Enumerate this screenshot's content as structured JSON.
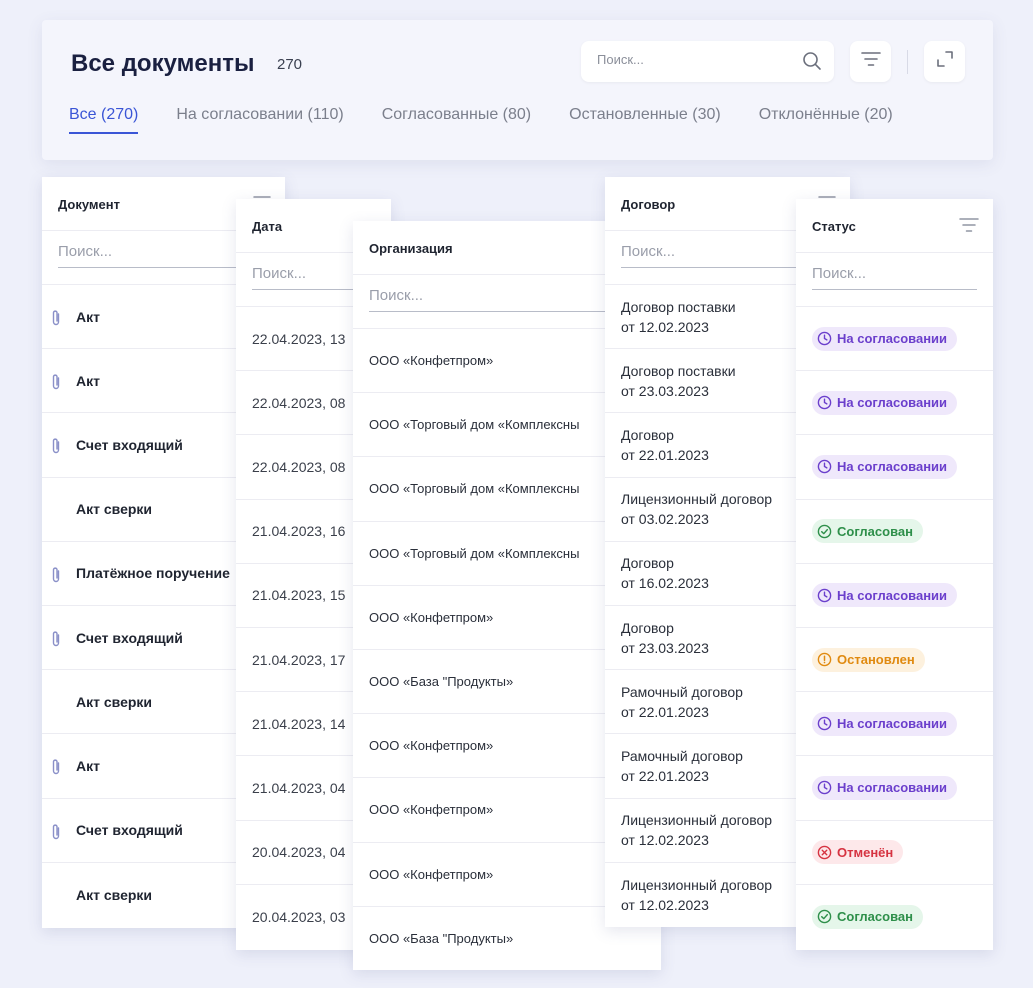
{
  "header": {
    "title": "Все документы",
    "count": "270",
    "search_placeholder": "Поиск...",
    "tabs": [
      {
        "label": "Все (270)",
        "active": true
      },
      {
        "label": "На согласовании (110)"
      },
      {
        "label": "Согласованные (80)"
      },
      {
        "label": "Остановленные (30)"
      },
      {
        "label": "Отклонённые (20)"
      }
    ]
  },
  "colors": {
    "accent": "#3a55d6",
    "pending": "#6b3fcc",
    "approved": "#2e8f4a",
    "stopped": "#e08a10",
    "cancelled": "#d63341"
  },
  "columns": {
    "document": {
      "title": "Документ",
      "search_placeholder": "Поиск..."
    },
    "date": {
      "title": "Дата",
      "search_placeholder": "Поиск..."
    },
    "organization": {
      "title": "Организация",
      "search_placeholder": "Поиск..."
    },
    "contract": {
      "title": "Договор",
      "search_placeholder": "Поиск..."
    },
    "status": {
      "title": "Статус",
      "search_placeholder": "Поиск..."
    }
  },
  "documents": [
    {
      "name": "Акт",
      "attachment": true
    },
    {
      "name": "Акт",
      "attachment": true
    },
    {
      "name": "Счет входящий",
      "attachment": true
    },
    {
      "name": "Акт сверки",
      "attachment": false
    },
    {
      "name": "Платёжное поручение",
      "attachment": true
    },
    {
      "name": "Счет входящий",
      "attachment": true
    },
    {
      "name": "Акт сверки",
      "attachment": false
    },
    {
      "name": "Акт",
      "attachment": true
    },
    {
      "name": "Счет входящий",
      "attachment": true
    },
    {
      "name": "Акт сверки",
      "attachment": false
    }
  ],
  "dates": [
    "22.04.2023, 13",
    "22.04.2023, 08",
    "22.04.2023, 08",
    "21.04.2023, 16",
    "21.04.2023, 15",
    "21.04.2023, 17",
    "21.04.2023, 14",
    "21.04.2023, 04",
    "20.04.2023, 04",
    "20.04.2023, 03"
  ],
  "organizations": [
    "ООО «Конфетпром»",
    "ООО «Торговый дом «Комплексны",
    "ООО «Торговый дом «Комплексны",
    "ООО «Торговый дом «Комплексны",
    "ООО «Конфетпром»",
    "ООО «База \"Продукты»",
    "ООО «Конфетпром»",
    "ООО «Конфетпром»",
    "ООО «Конфетпром»",
    "ООО «База \"Продукты»"
  ],
  "contracts": [
    {
      "line1": "Договор поставки",
      "line2": "от 12.02.2023"
    },
    {
      "line1": "Договор поставки",
      "line2": "от 23.03.2023"
    },
    {
      "line1": "Договор",
      "line2": "от 22.01.2023"
    },
    {
      "line1": "Лицензионный договор",
      "line2": "от 03.02.2023"
    },
    {
      "line1": "Договор",
      "line2": "от 16.02.2023"
    },
    {
      "line1": "Договор",
      "line2": "от 23.03.2023"
    },
    {
      "line1": "Рамочный договор",
      "line2": "от 22.01.2023"
    },
    {
      "line1": "Рамочный договор",
      "line2": "от 22.01.2023"
    },
    {
      "line1": "Лицензионный договор",
      "line2": "от 12.02.2023"
    },
    {
      "line1": "Лицензионный договор",
      "line2": "от 12.02.2023"
    }
  ],
  "statuses": [
    {
      "label": "На согласовании",
      "kind": "pending"
    },
    {
      "label": "На согласовании",
      "kind": "pending"
    },
    {
      "label": "На согласовании",
      "kind": "pending"
    },
    {
      "label": "Согласован",
      "kind": "approved"
    },
    {
      "label": "На согласовании",
      "kind": "pending"
    },
    {
      "label": "Остановлен",
      "kind": "stopped"
    },
    {
      "label": "На согласовании",
      "kind": "pending"
    },
    {
      "label": "На согласовании",
      "kind": "pending"
    },
    {
      "label": "Отменён",
      "kind": "cancelled"
    },
    {
      "label": "Согласован",
      "kind": "approved"
    }
  ]
}
